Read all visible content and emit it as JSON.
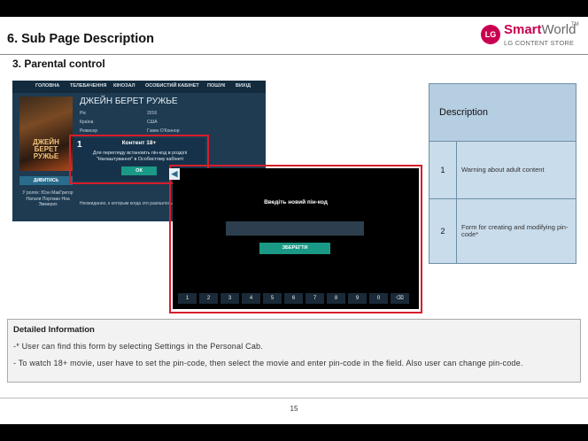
{
  "header": {
    "page_title": "6. Sub Page Description",
    "section_title": "3. Parental control",
    "logo": {
      "brand": "Smart",
      "brand2": "World",
      "tm": "TM",
      "sub": "LG CONTENT STORE",
      "mark": "LG"
    }
  },
  "shot1": {
    "nav": [
      "ГОЛОВНА",
      "ТЕЛЕБАЧЕННЯ",
      "КІНОЗАЛ",
      "ОСОБИСТИЙ КАБІНЕТ",
      "ПОШУК",
      "ВИХІД"
    ],
    "poster_title": "ДЖЕЙН БЕРЕТ РУЖЬЕ",
    "watch_label": "ДИВИТИСЬ",
    "cast": "У ролях: Юэн МакГрегор Натали Портман Ноа Эммерих",
    "movie_title": "ДЖЕЙН БЕРЕТ РУЖЬЕ",
    "info": [
      {
        "label": "Рік",
        "value": "2016"
      },
      {
        "label": "Країна",
        "value": "США"
      },
      {
        "label": "Режисер",
        "value": "Гэвин О'Коннор"
      }
    ],
    "desc": "Неожиданно, к которым когда это разошлось людьми.",
    "dialog": {
      "badge": "1",
      "title": "Контент 18+",
      "message": "Для перегляду встановіть пін-код в розділі \"Налаштування\" в Особистому кабінеті",
      "ok_label": "ОК"
    }
  },
  "shot2": {
    "badge": "2",
    "back_arrow": "◀",
    "pin_title": "Введіть новий пін-код",
    "save_label": "ЗБЕРЕГТИ",
    "keys": [
      "1",
      "2",
      "3",
      "4",
      "5",
      "6",
      "7",
      "8",
      "9",
      "0",
      "⌫"
    ]
  },
  "table": {
    "header": "Description",
    "rows": [
      {
        "num": "1",
        "text": "Warning about adult content"
      },
      {
        "num": "2",
        "text": "Form for creating and modifying  pin-code*"
      }
    ]
  },
  "detail": {
    "title": "Detailed Information",
    "lines": [
      "-* User can find this form by selecting Settings in the Personal Cab.",
      "- To watch 18+ movie, user have to set the pin-code, then select the movie and enter pin-code in the field. Also user can change pin-code."
    ]
  },
  "page_number": "15"
}
